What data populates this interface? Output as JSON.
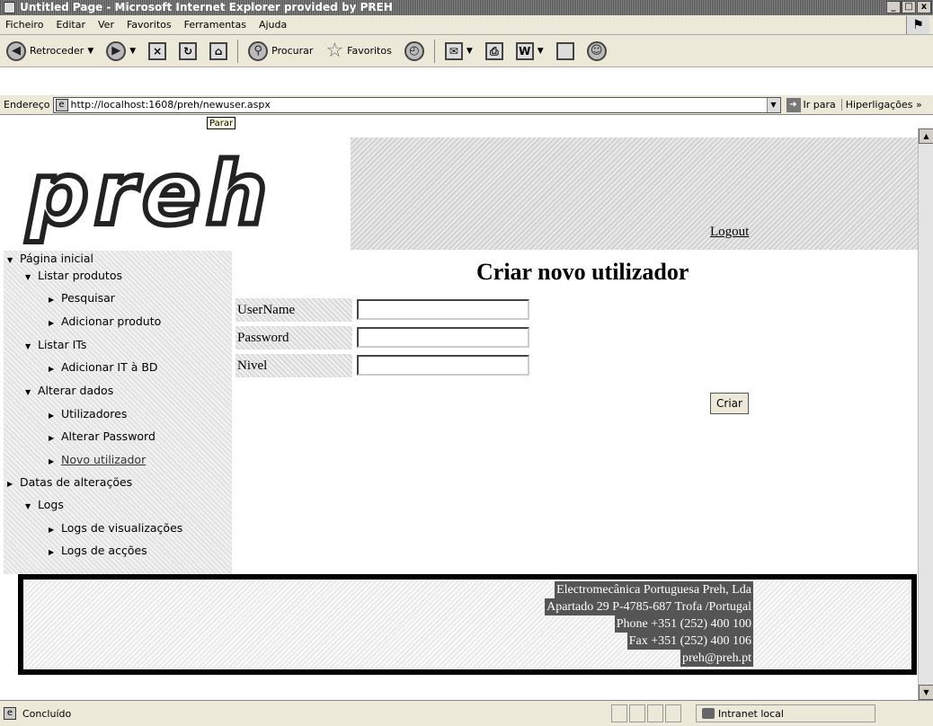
{
  "window": {
    "title": "Untitled Page - Microsoft Internet Explorer provided by PREH",
    "buttons": [
      "_",
      "□",
      "x"
    ]
  },
  "menu": [
    "Ficheiro",
    "Editar",
    "Ver",
    "Favoritos",
    "Ferramentas",
    "Ajuda"
  ],
  "toolbar": {
    "back_label": "Retroceder",
    "search_label": "Procurar",
    "favorites_label": "Favoritos"
  },
  "address": {
    "label": "Endereço",
    "url": "http://localhost:1608/preh/newuser.aspx",
    "go_label": "Ir para",
    "links_label": "Hiperligações"
  },
  "tooltip": "Parar",
  "header": {
    "logo_text": "preh",
    "logout_label": "Logout"
  },
  "sidebar": {
    "items": [
      {
        "label": "Página inicial",
        "level": 0,
        "expanded": true
      },
      {
        "label": "Listar produtos",
        "level": 1,
        "expanded": true
      },
      {
        "label": "Pesquisar",
        "level": 2,
        "expanded": false
      },
      {
        "label": "Adicionar produto",
        "level": 2,
        "expanded": false
      },
      {
        "label": "Listar ITs",
        "level": 1,
        "expanded": true
      },
      {
        "label": "Adicionar IT à BD",
        "level": 2,
        "expanded": false
      },
      {
        "label": "Alterar dados",
        "level": 1,
        "expanded": true
      },
      {
        "label": "Utilizadores",
        "level": 2,
        "expanded": false
      },
      {
        "label": "Alterar Password",
        "level": 2,
        "expanded": false
      },
      {
        "label": "Novo utilizador",
        "level": 2,
        "expanded": false,
        "current": true
      },
      {
        "label": "Datas de alterações",
        "level": 1,
        "expanded": false
      },
      {
        "label": "Logs",
        "level": 1,
        "expanded": true
      },
      {
        "label": "Logs de visualizações",
        "level": 2,
        "expanded": false
      },
      {
        "label": "Logs de acções",
        "level": 2,
        "expanded": false
      }
    ]
  },
  "form": {
    "title": "Criar novo utilizador",
    "fields": [
      {
        "label": "UserName",
        "value": ""
      },
      {
        "label": "Password",
        "value": ""
      },
      {
        "label": "Nivel",
        "value": ""
      }
    ],
    "submit_label": "Criar"
  },
  "footer": {
    "lines": [
      "Electromecânica Portuguesa Preh, Lda",
      "Apartado 29 P-4785-687 Trofa /Portugal",
      "Phone +351 (252) 400 100",
      "Fax +351 (252) 400 106",
      "preh@preh.pt"
    ]
  },
  "status": {
    "text": "Concluído",
    "zone": "Intranet local"
  }
}
